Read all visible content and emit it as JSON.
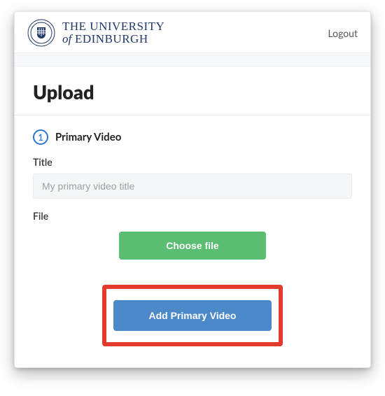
{
  "header": {
    "brand_line1": "THE UNIVERSITY",
    "brand_of": "of",
    "brand_line2": " EDINBURGH",
    "logout_label": "Logout"
  },
  "page": {
    "title": "Upload"
  },
  "step": {
    "number": "1",
    "title": "Primary Video"
  },
  "form": {
    "title_label": "Title",
    "title_placeholder": "My primary video title",
    "title_value": "",
    "file_label": "File",
    "choose_file_label": "Choose file",
    "submit_label": "Add Primary Video"
  },
  "colors": {
    "accent_blue": "#2a76d2",
    "button_blue": "#4b89c8",
    "button_green": "#5bbd72",
    "highlight_red": "#e23b2e",
    "brand_navy": "#1f3864"
  }
}
